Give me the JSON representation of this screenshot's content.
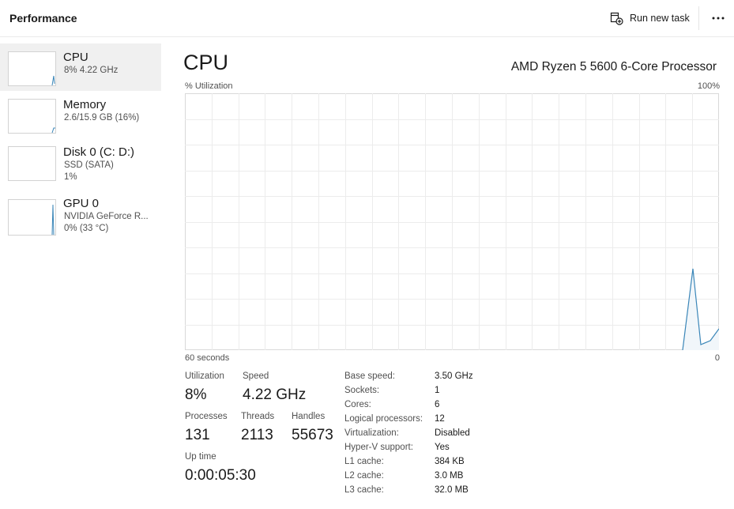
{
  "header": {
    "title": "Performance",
    "run_new_task_label": "Run new task",
    "run_new_task_icon": "run-task-icon",
    "more_icon": "more-options-icon"
  },
  "sidebar": {
    "items": [
      {
        "name": "CPU",
        "line1": "8%  4.22 GHz",
        "line2": "",
        "selected": true
      },
      {
        "name": "Memory",
        "line1": "2.6/15.9 GB (16%)",
        "line2": "",
        "selected": false
      },
      {
        "name": "Disk 0 (C: D:)",
        "line1": "SSD (SATA)",
        "line2": "1%",
        "selected": false
      },
      {
        "name": "GPU 0",
        "line1": "NVIDIA GeForce R...",
        "line2": "0%  (33 °C)",
        "selected": false
      }
    ]
  },
  "main": {
    "title": "CPU",
    "processor": "AMD Ryzen 5 5600 6-Core Processor",
    "graph": {
      "y_label": "% Utilization",
      "y_max_label": "100%",
      "x_label": "60 seconds",
      "x_min_label": "0",
      "line_color": "#3a86b8",
      "fill_color": "#f1f6fa"
    }
  },
  "stats": {
    "utilization_label": "Utilization",
    "utilization": "8%",
    "speed_label": "Speed",
    "speed": "4.22 GHz",
    "processes_label": "Processes",
    "processes": "131",
    "threads_label": "Threads",
    "threads": "2113",
    "handles_label": "Handles",
    "handles": "55673",
    "uptime_label": "Up time",
    "uptime": "0:00:05:30"
  },
  "info": [
    {
      "key": "Base speed:",
      "value": "3.50 GHz"
    },
    {
      "key": "Sockets:",
      "value": "1"
    },
    {
      "key": "Cores:",
      "value": "6"
    },
    {
      "key": "Logical processors:",
      "value": "12"
    },
    {
      "key": "Virtualization:",
      "value": "Disabled"
    },
    {
      "key": "Hyper-V support:",
      "value": "Yes"
    },
    {
      "key": "L1 cache:",
      "value": "384 KB"
    },
    {
      "key": "L2 cache:",
      "value": "3.0 MB"
    },
    {
      "key": "L3 cache:",
      "value": "32.0 MB"
    }
  ]
}
